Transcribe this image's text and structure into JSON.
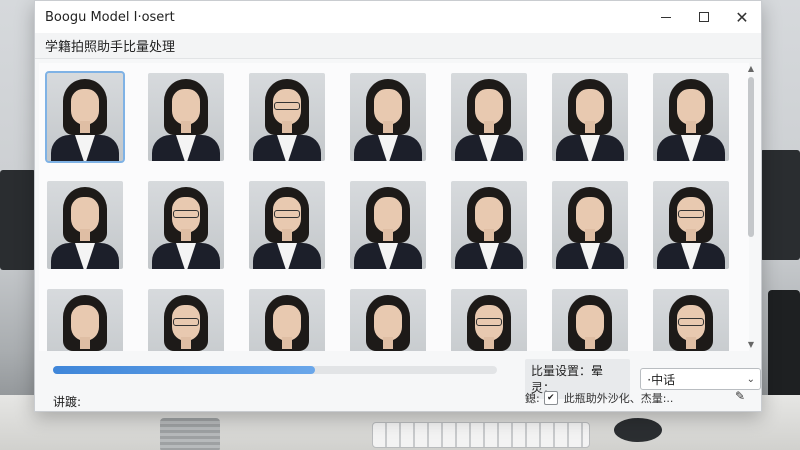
{
  "window": {
    "title": "Boogu Model I·osert",
    "subtitle": "学籍拍照助手比量处理"
  },
  "gallery": {
    "photos": [
      {
        "row": 1,
        "col": 1,
        "selected": true,
        "glasses": false
      },
      {
        "row": 1,
        "col": 2,
        "selected": false,
        "glasses": false
      },
      {
        "row": 1,
        "col": 3,
        "selected": false,
        "glasses": true
      },
      {
        "row": 1,
        "col": 4,
        "selected": false,
        "glasses": false
      },
      {
        "row": 1,
        "col": 5,
        "selected": false,
        "glasses": false
      },
      {
        "row": 1,
        "col": 6,
        "selected": false,
        "glasses": false
      },
      {
        "row": 1,
        "col": 7,
        "selected": false,
        "glasses": false
      },
      {
        "row": 2,
        "col": 1,
        "selected": false,
        "glasses": false
      },
      {
        "row": 2,
        "col": 2,
        "selected": false,
        "glasses": true
      },
      {
        "row": 2,
        "col": 3,
        "selected": false,
        "glasses": true
      },
      {
        "row": 2,
        "col": 4,
        "selected": false,
        "glasses": false
      },
      {
        "row": 2,
        "col": 5,
        "selected": false,
        "glasses": false
      },
      {
        "row": 2,
        "col": 6,
        "selected": false,
        "glasses": false
      },
      {
        "row": 2,
        "col": 7,
        "selected": false,
        "glasses": true
      },
      {
        "row": 3,
        "col": 1,
        "selected": false,
        "glasses": false
      },
      {
        "row": 3,
        "col": 2,
        "selected": false,
        "glasses": true
      },
      {
        "row": 3,
        "col": 3,
        "selected": false,
        "glasses": false
      },
      {
        "row": 3,
        "col": 4,
        "selected": false,
        "glasses": false
      },
      {
        "row": 3,
        "col": 5,
        "selected": false,
        "glasses": true
      },
      {
        "row": 3,
        "col": 6,
        "selected": false,
        "glasses": false
      },
      {
        "row": 3,
        "col": 7,
        "selected": false,
        "glasses": true
      }
    ]
  },
  "progress": {
    "percent": 59
  },
  "settings": {
    "label": "比量设置：晕灵：",
    "selected_value": "·中话"
  },
  "status": {
    "label": "讲踱:"
  },
  "options": {
    "prefix": "鎴:",
    "checkbox_mark": "✔",
    "text": "此瓶助外沙化、杰量:.."
  },
  "icons": {
    "minimize": "minimize-icon",
    "maximize": "maximize-icon",
    "close": "close-icon",
    "dropdown": "chevron-down-icon",
    "edit": "pencil-icon"
  },
  "colors": {
    "accent": "#3f86d9",
    "selection_outline": "#7fb2e5"
  }
}
